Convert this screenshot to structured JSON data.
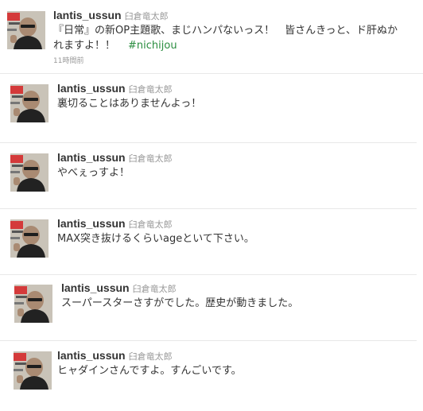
{
  "user": {
    "screen_name": "lantis_ussun",
    "full_name": "臼倉竜太郎"
  },
  "tweets": [
    {
      "line1": "『日常』の新OP主題歌、まじハンパないっス！　皆さんきっと、ド肝ぬか",
      "line2": "れますよ！！",
      "hashtag": "#nichijou",
      "timestamp": "11時間前"
    },
    {
      "text": "裏切ることはありませんよっ！"
    },
    {
      "text": "やべぇっすよ！"
    },
    {
      "text": "MAX突き抜けるくらいageといて下さい。"
    },
    {
      "text": "スーパースターさすがでした。歴史が動きました。"
    },
    {
      "text": "ヒャダインさんですよ。すんごいです。"
    }
  ],
  "colors": {
    "hashtag": "#2a8d3f",
    "meta_gray": "#999999",
    "text": "#333333",
    "separator": "#e8e8e8"
  },
  "icons": [
    "user-avatar"
  ]
}
